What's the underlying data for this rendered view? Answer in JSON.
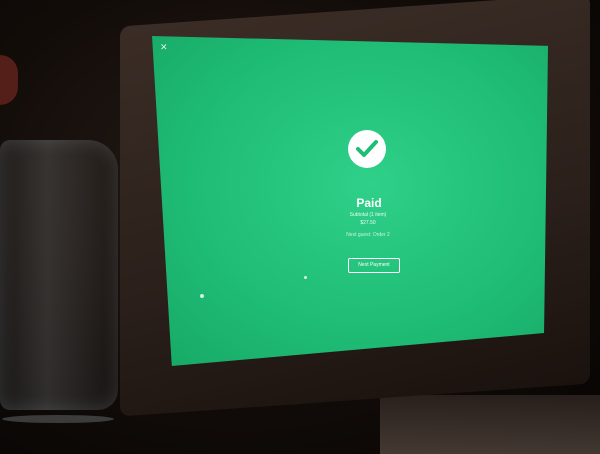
{
  "screen": {
    "close_label": "✕",
    "status_title": "Paid",
    "details": {
      "line1": "Subtotal (1 item)",
      "line2": "$27.50",
      "line3": "Next guest: Order 2"
    },
    "next_button_label": "Next Payment"
  },
  "colors": {
    "screen_green": "#1fbd76",
    "text": "#ffffff"
  },
  "icons": {
    "status": "checkmark-circle-icon",
    "close": "close-icon"
  }
}
